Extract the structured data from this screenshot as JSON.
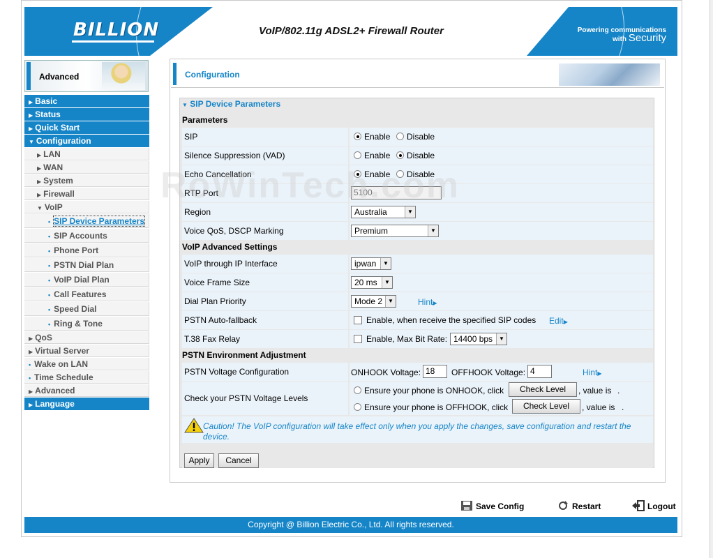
{
  "header": {
    "logo": "BILLION",
    "product": "VoIP/802.11g ADSL2+ Firewall Router",
    "tagline_top": "Powering communications",
    "tagline_mid": "with",
    "tagline_sec": "Security"
  },
  "sidebar": {
    "section_label": "Advanced",
    "top_items": [
      "Basic",
      "Status",
      "Quick Start",
      "Configuration"
    ],
    "config_items": [
      "LAN",
      "WAN",
      "System",
      "Firewall",
      "VoIP"
    ],
    "voip_items": [
      "SIP Device Parameters",
      "SIP Accounts",
      "Phone Port",
      "PSTN Dial Plan",
      "VoIP Dial Plan",
      "Call Features",
      "Speed Dial",
      "Ring & Tone"
    ],
    "after_items": [
      "QoS",
      "Virtual Server",
      "Wake on LAN",
      "Time Schedule",
      "Advanced"
    ],
    "language": "Language"
  },
  "main": {
    "title": "Configuration",
    "section_title": "SIP Device Parameters",
    "group_parameters": "Parameters",
    "group_advanced": "VoIP Advanced Settings",
    "group_pstn": "PSTN Environment Adjustment",
    "enable": "Enable",
    "disable": "Disable",
    "sip_label": "SIP",
    "vad_label": "Silence Suppression (VAD)",
    "echo_label": "Echo Cancellation",
    "rtp_label": "RTP Port",
    "rtp_value": "5100",
    "region_label": "Region",
    "region_value": "Australia",
    "qos_label": "Voice QoS, DSCP Marking",
    "qos_value": "Premium",
    "ip_if_label": "VoIP through IP Interface",
    "ip_if_value": "ipwan",
    "frame_label": "Voice Frame Size",
    "frame_value": "20 ms",
    "dial_label": "Dial Plan Priority",
    "dial_value": "Mode 2",
    "hint": "Hint",
    "fallback_label": "PSTN Auto-fallback",
    "fallback_text": "Enable, when receive the specified SIP codes",
    "edit": "Edit",
    "fax_label": "T.38 Fax Relay",
    "fax_text": "Enable, Max Bit Rate:",
    "fax_value": "14400 bps",
    "voltage_label": "PSTN Voltage Configuration",
    "onhook_label": "ONHOOK Voltage:",
    "onhook_value": "18",
    "offhook_label": "OFFHOOK Voltage:",
    "offhook_value": "4",
    "check_label": "Check your PSTN Voltage Levels",
    "ensure_onhook": "Ensure your phone is ONHOOK, click",
    "ensure_offhook": "Ensure your phone is OFFHOOK, click",
    "check_level": "Check Level",
    "value_is": ", value is",
    "period": ".",
    "caution": "Caution! The VoIP configuration will take effect only when you apply the changes, save configuration and restart the device.",
    "apply": "Apply",
    "cancel": "Cancel"
  },
  "footer": {
    "save_config": "Save Config",
    "restart": "Restart",
    "logout": "Logout",
    "copyright": "Copyright @ Billion Electric Co., Ltd. All rights reserved."
  },
  "watermark": "RoWinTech.com",
  "colors": {
    "brand_blue": "#1585c8",
    "row_bg": "#ebf3fa",
    "panel_bg": "#e8e8e8"
  }
}
